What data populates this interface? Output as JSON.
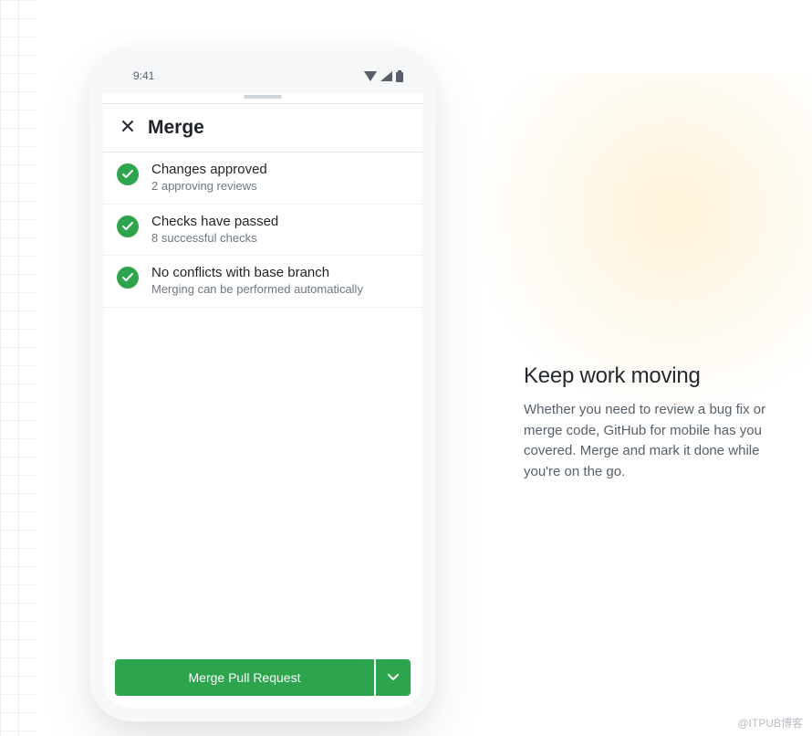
{
  "status_bar": {
    "time": "9:41"
  },
  "sheet": {
    "title": "Merge",
    "close_label": "Close",
    "items": [
      {
        "title": "Changes approved",
        "subtitle": "2 approving reviews"
      },
      {
        "title": "Checks have passed",
        "subtitle": "8 successful checks"
      },
      {
        "title": "No conflicts with base branch",
        "subtitle": "Merging can be performed automatically"
      }
    ],
    "merge_button": "Merge Pull Request"
  },
  "marketing": {
    "heading": "Keep work moving",
    "body": "Whether you need to review a bug fix or merge code, GitHub for mobile has you covered. Merge and mark it done while you're on the go."
  },
  "watermark": "@ITPUB博客"
}
